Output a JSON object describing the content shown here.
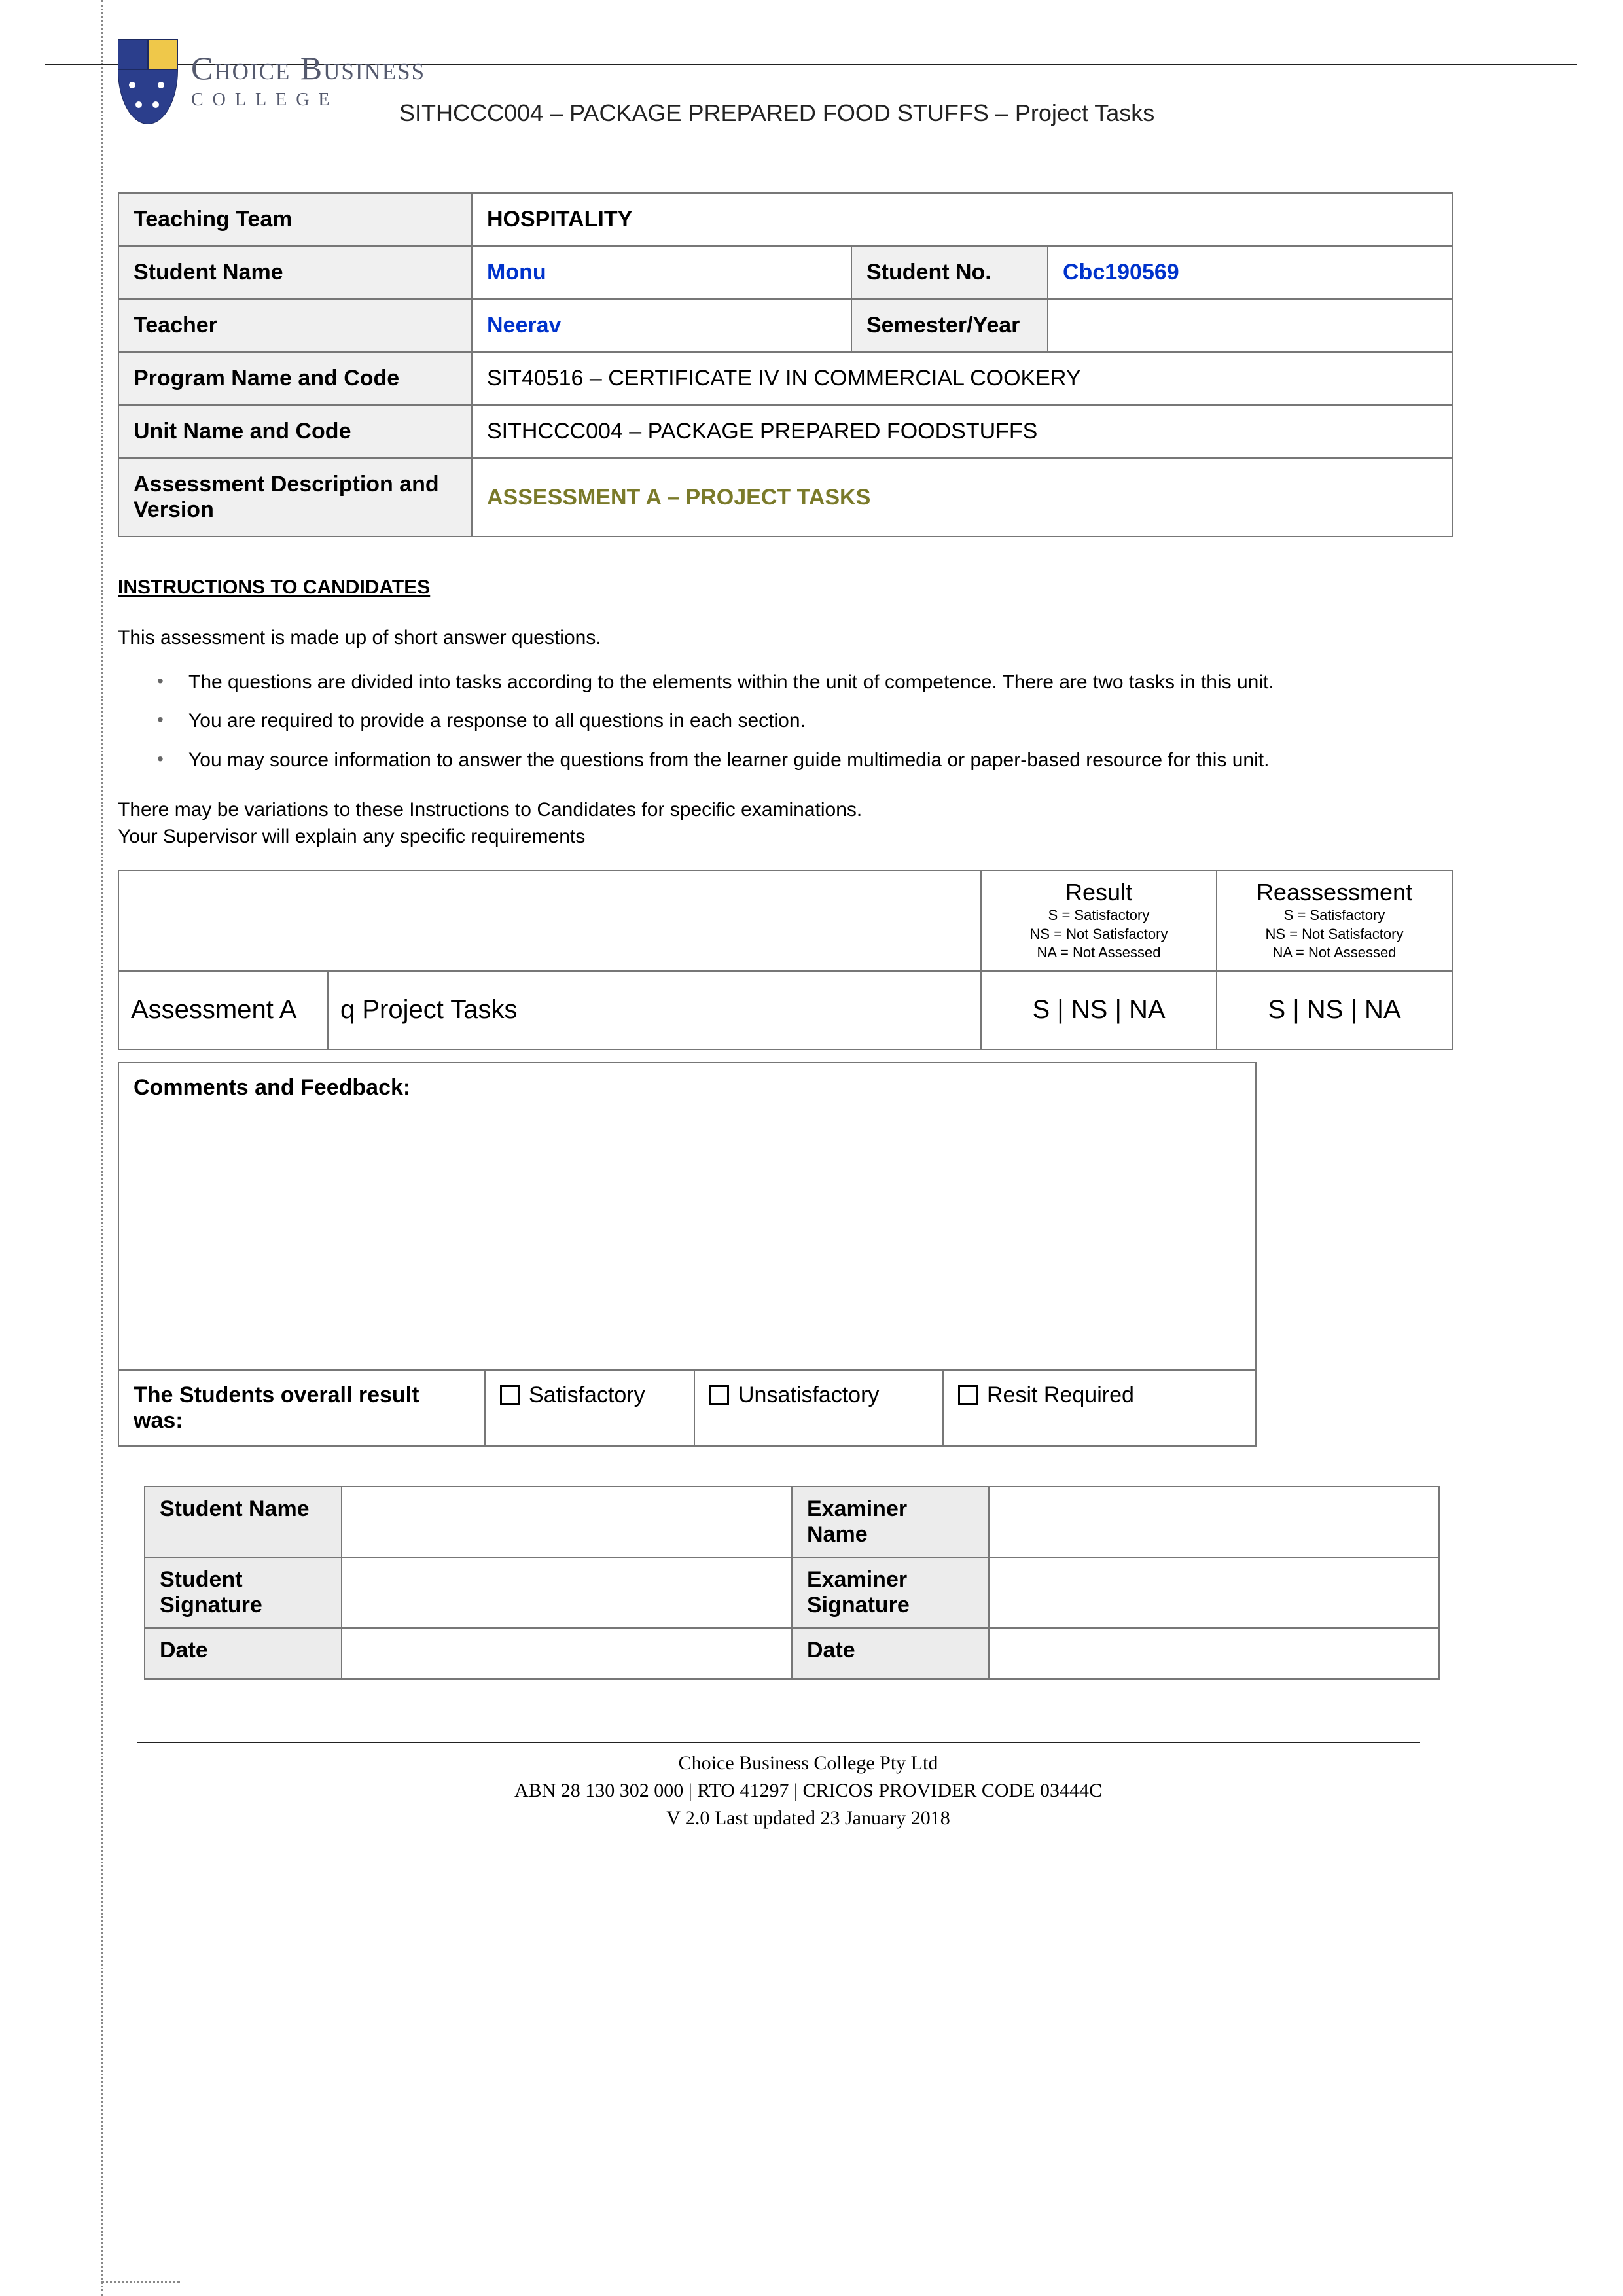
{
  "brand": {
    "name": "Choice Business",
    "sub": "COLLEGE"
  },
  "doc_title": "SITHCCC004 – PACKAGE PREPARED FOOD STUFFS – Project Tasks",
  "info": {
    "teaching_team_label": "Teaching Team",
    "teaching_team_value": "HOSPITALITY",
    "student_name_label": "Student Name",
    "student_name_value": "Monu",
    "student_no_label": "Student No.",
    "student_no_value": "Cbc190569",
    "teacher_label": "Teacher",
    "teacher_value": "Neerav",
    "semester_label": "Semester/Year",
    "semester_value": "",
    "program_label": "Program Name and Code",
    "program_value": "SIT40516 – CERTIFICATE IV IN COMMERCIAL COOKERY",
    "unit_label": "Unit Name and Code",
    "unit_value": "SITHCCC004 – PACKAGE PREPARED FOODSTUFFS",
    "assess_label": "Assessment Description and Version",
    "assess_value": "ASSESSMENT A – PROJECT TASKS"
  },
  "instructions": {
    "heading": "INSTRUCTIONS TO CANDIDATES",
    "intro": "This assessment is made up of short answer questions.",
    "bullets": [
      "The questions are divided into tasks according to the elements within the unit of competence. There are two tasks in this unit.",
      "You are required to provide a response to all questions in each section.",
      "You may source information to answer the questions from the learner guide multimedia or paper-based resource for this unit."
    ],
    "note1": "There may be variations to these Instructions to Candidates for specific examinations.",
    "note2": "Your Supervisor will explain any specific requirements"
  },
  "result_block": {
    "result_hdr": "Result",
    "reassess_hdr": "Reassessment",
    "legend_s": "S = Satisfactory",
    "legend_ns": "NS = Not Satisfactory",
    "legend_na": "NA = Not Assessed",
    "assessment_label": "Assessment A",
    "assessment_name": "q Project Tasks",
    "codes": "S   |   NS   |   NA"
  },
  "comments": {
    "heading": "Comments and Feedback:",
    "overall_label": "The Students overall result was:",
    "opt_sat": "Satisfactory",
    "opt_unsat": "Unsatisfactory",
    "opt_resit": "Resit Required"
  },
  "signatures": {
    "student_name": "Student Name",
    "examiner_name": "Examiner Name",
    "student_sig": "Student Signature",
    "examiner_sig": "Examiner Signature",
    "date": "Date"
  },
  "footer": {
    "line1": "Choice Business College Pty Ltd",
    "line2": "ABN 28 130 302 000 | RTO 41297 | CRICOS PROVIDER CODE 03444C",
    "line3": "V 2.0 Last updated 23 January 2018"
  }
}
